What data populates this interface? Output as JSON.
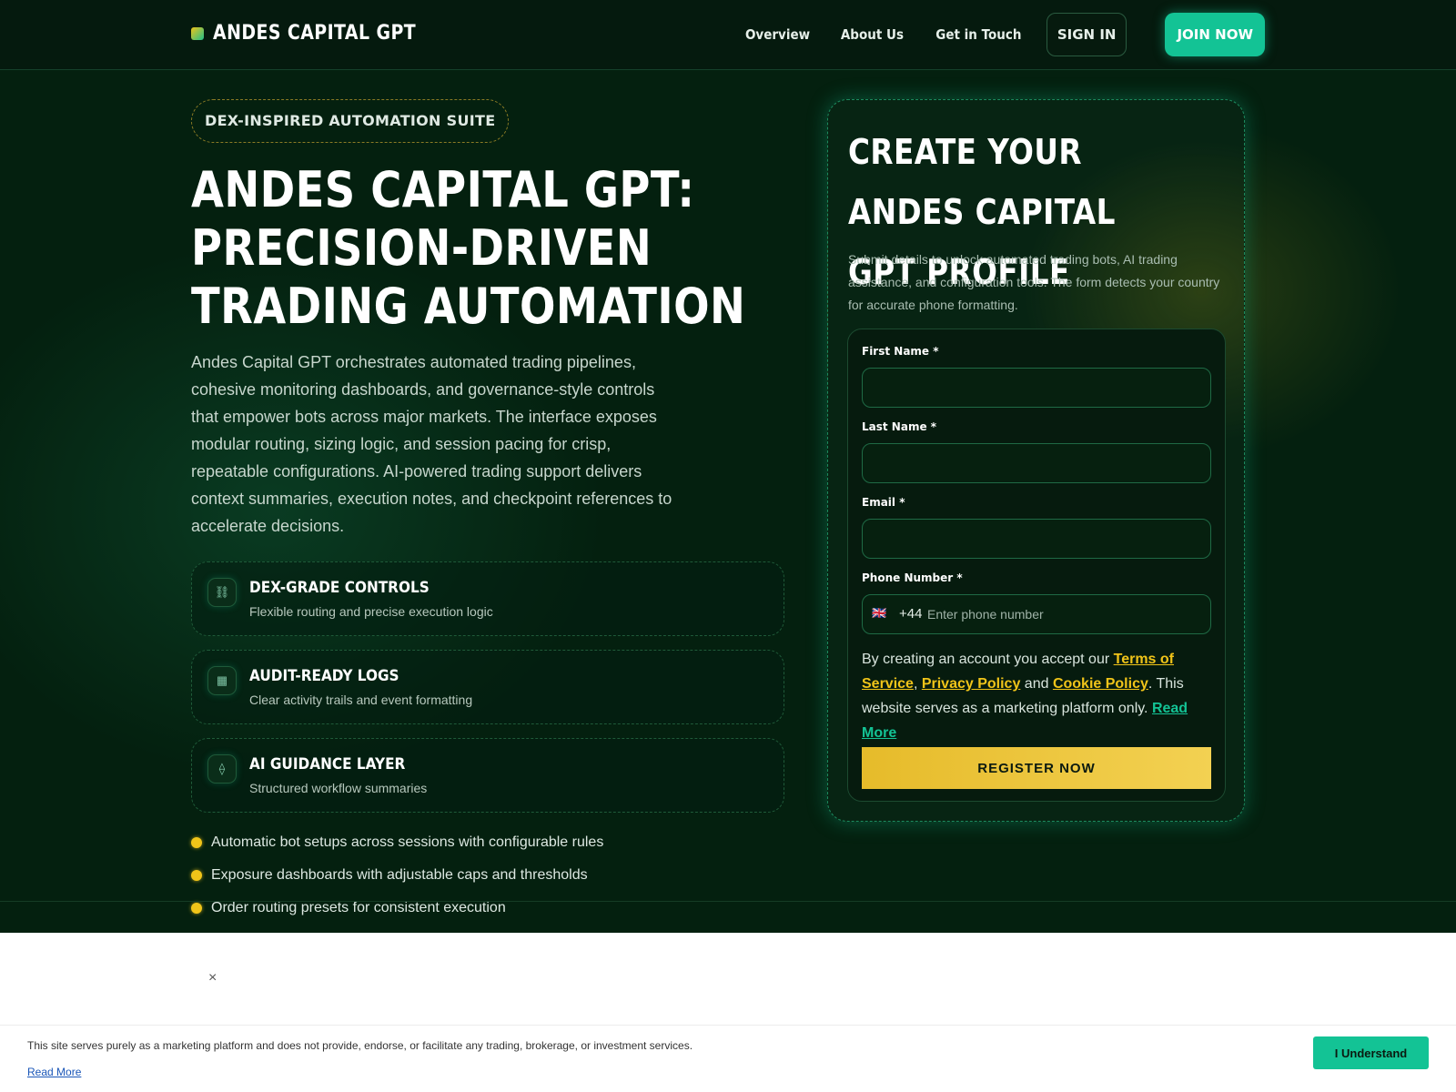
{
  "header": {
    "brand": "ANDES CAPITAL GPT",
    "nav": [
      "Overview",
      "About Us",
      "Get in Touch"
    ],
    "sign_in": "SIGN IN",
    "join_now": "JOIN NOW"
  },
  "hero": {
    "pill": "DEX-INSPIRED AUTOMATION SUITE",
    "title": "ANDES CAPITAL GPT: PRECISION-DRIVEN TRADING AUTOMATION",
    "description": "Andes Capital GPT orchestrates automated trading pipelines, cohesive monitoring dashboards, and governance-style controls that empower bots across major markets. The interface exposes modular routing, sizing logic, and session pacing for crisp, repeatable configurations. AI-powered trading support delivers context summaries, execution notes, and checkpoint references to accelerate decisions.",
    "features": [
      {
        "icon": "link-icon",
        "glyph": "⛓",
        "title": "DEX-GRADE CONTROLS",
        "subtitle": "Flexible routing and precise execution logic"
      },
      {
        "icon": "grid-icon",
        "glyph": "▦",
        "title": "AUDIT-READY LOGS",
        "subtitle": "Clear activity trails and event formatting"
      },
      {
        "icon": "diamond-icon",
        "glyph": "⟠",
        "title": "AI GUIDANCE LAYER",
        "subtitle": "Structured workflow summaries"
      }
    ],
    "bullets": [
      "Automatic bot setups across sessions with configurable rules",
      "Exposure dashboards with adjustable caps and thresholds",
      "Order routing presets for consistent execution"
    ]
  },
  "form": {
    "title": "CREATE YOUR ANDES CAPITAL GPT PROFILE",
    "description": "Submit details to unlock automated trading bots, AI trading assistance, and configuration tools. The form detects your country for accurate phone formatting.",
    "first_name_label": "First Name *",
    "last_name_label": "Last Name *",
    "email_label": "Email *",
    "phone_label": "Phone Number *",
    "phone_flag": "🇬🇧",
    "phone_code": "+44",
    "phone_placeholder": "Enter phone number",
    "legal": {
      "prefix": "By creating an account you accept our ",
      "terms": "Terms of Service",
      "comma": ", ",
      "privacy": "Privacy Policy",
      "and": " and ",
      "cookie": "Cookie Policy",
      "suffix": ". This website serves as a marketing platform only. ",
      "read_more": "Read More"
    },
    "register": "REGISTER NOW"
  },
  "cookie": {
    "close": "×",
    "text": "This site serves purely as a marketing platform and does not provide, endorse, or facilitate any trading, brokerage, or investment services.",
    "read_more": "Read More",
    "button": "I Understand"
  },
  "colors": {
    "background": "#04200f",
    "accent_green": "#13c395",
    "accent_yellow": "#f0c419"
  }
}
